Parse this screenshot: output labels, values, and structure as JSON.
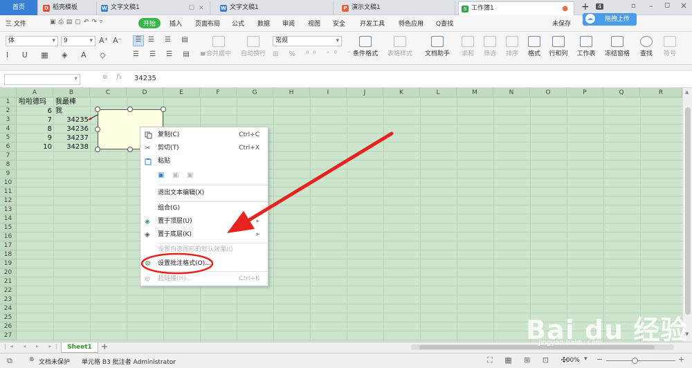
{
  "tabs": [
    {
      "label": "首页",
      "icon": ""
    },
    {
      "label": "稻壳模板",
      "icon": "docer-icon",
      "color": "#e24a33"
    },
    {
      "label": "文字文稿1",
      "icon": "writer-icon",
      "color": "#3a7fd6"
    },
    {
      "label": "文字文稿1",
      "icon": "writer-icon",
      "color": "#3a7fd6"
    },
    {
      "label": "演示文稿1",
      "icon": "presentation-icon",
      "color": "#e8623a"
    },
    {
      "label": "工作簿1",
      "icon": "spreadsheet-icon",
      "color": "#2ea84a"
    }
  ],
  "tab_count": "4",
  "upload_label": "拖拽上传",
  "ribbon_tabs": [
    "三 文件",
    "开始",
    "插入",
    "页面布局",
    "公式",
    "数据",
    "审阅",
    "视图",
    "安全",
    "开发工具",
    "特色应用",
    "Q查找"
  ],
  "unsaved_label": "未保存",
  "font_name": "体",
  "font_size": "9",
  "number_format": "常规",
  "toolbar_labels": {
    "merge": "合并居中",
    "wrap": "自动换行",
    "cond_format": "条件格式",
    "table_style": "表格样式",
    "doc_helper": "文档助手",
    "sum": "求和",
    "filter": "筛选",
    "sort": "排序",
    "format": "格式",
    "rowcol": "行和列",
    "worksheet": "工作表",
    "freeze": "冻结窗格",
    "find": "查找",
    "symbol": "符号"
  },
  "formula": {
    "fx": "fx",
    "value": "34235"
  },
  "columns": [
    "A",
    "B",
    "C",
    "D",
    "E",
    "F",
    "G",
    "H",
    "I",
    "J",
    "K",
    "L",
    "M",
    "N",
    "O",
    "P",
    "Q",
    "R"
  ],
  "rows": [
    "1",
    "2",
    "3",
    "4",
    "5",
    "6",
    "7",
    "8",
    "9",
    "10",
    "11",
    "12",
    "13",
    "14",
    "15",
    "16",
    "17",
    "18",
    "19",
    "20",
    "21",
    "22",
    "23",
    "24",
    "25",
    "26",
    "27",
    "28"
  ],
  "cells": {
    "a1": "啦啦德玛",
    "b1": "我最棒",
    "a2": "6",
    "b2": "我",
    "a3": "7",
    "b3": "34235",
    "a4": "8",
    "b4": "34236",
    "a5": "9",
    "b5": "34237",
    "a6": "10",
    "b6": "34238"
  },
  "sheet_tab": "Sheet1",
  "context_menu": {
    "copy": {
      "label": "复制(C)",
      "shortcut": "Ctrl+C"
    },
    "cut": {
      "label": "剪切(T)",
      "shortcut": "Ctrl+X"
    },
    "paste": {
      "label": "粘贴"
    },
    "exit_text_edit": {
      "label": "退出文本编辑(X)"
    },
    "group": {
      "label": "组合(G)"
    },
    "bring_front": {
      "label": "置于顶层(U)"
    },
    "send_back": {
      "label": "置于底层(K)"
    },
    "set_default": {
      "label": "设置自选图形的默认效果(I)"
    },
    "format_comment": {
      "label": "设置批注格式(O)..."
    },
    "hyperlink": {
      "label": "超链接(H)...",
      "shortcut": "Ctrl+K"
    }
  },
  "status": {
    "protect": "文档未保护",
    "cell_info": "单元格 B3 批注者 Administrator",
    "zoom": "100%"
  },
  "watermark": {
    "main": "Bai du 经验",
    "sub": "jingyan.baidu.com"
  },
  "colors": {
    "accent_green": "#3ab54a",
    "highlight_red": "#e8231f",
    "sheet_bg": "#cce5cc"
  }
}
